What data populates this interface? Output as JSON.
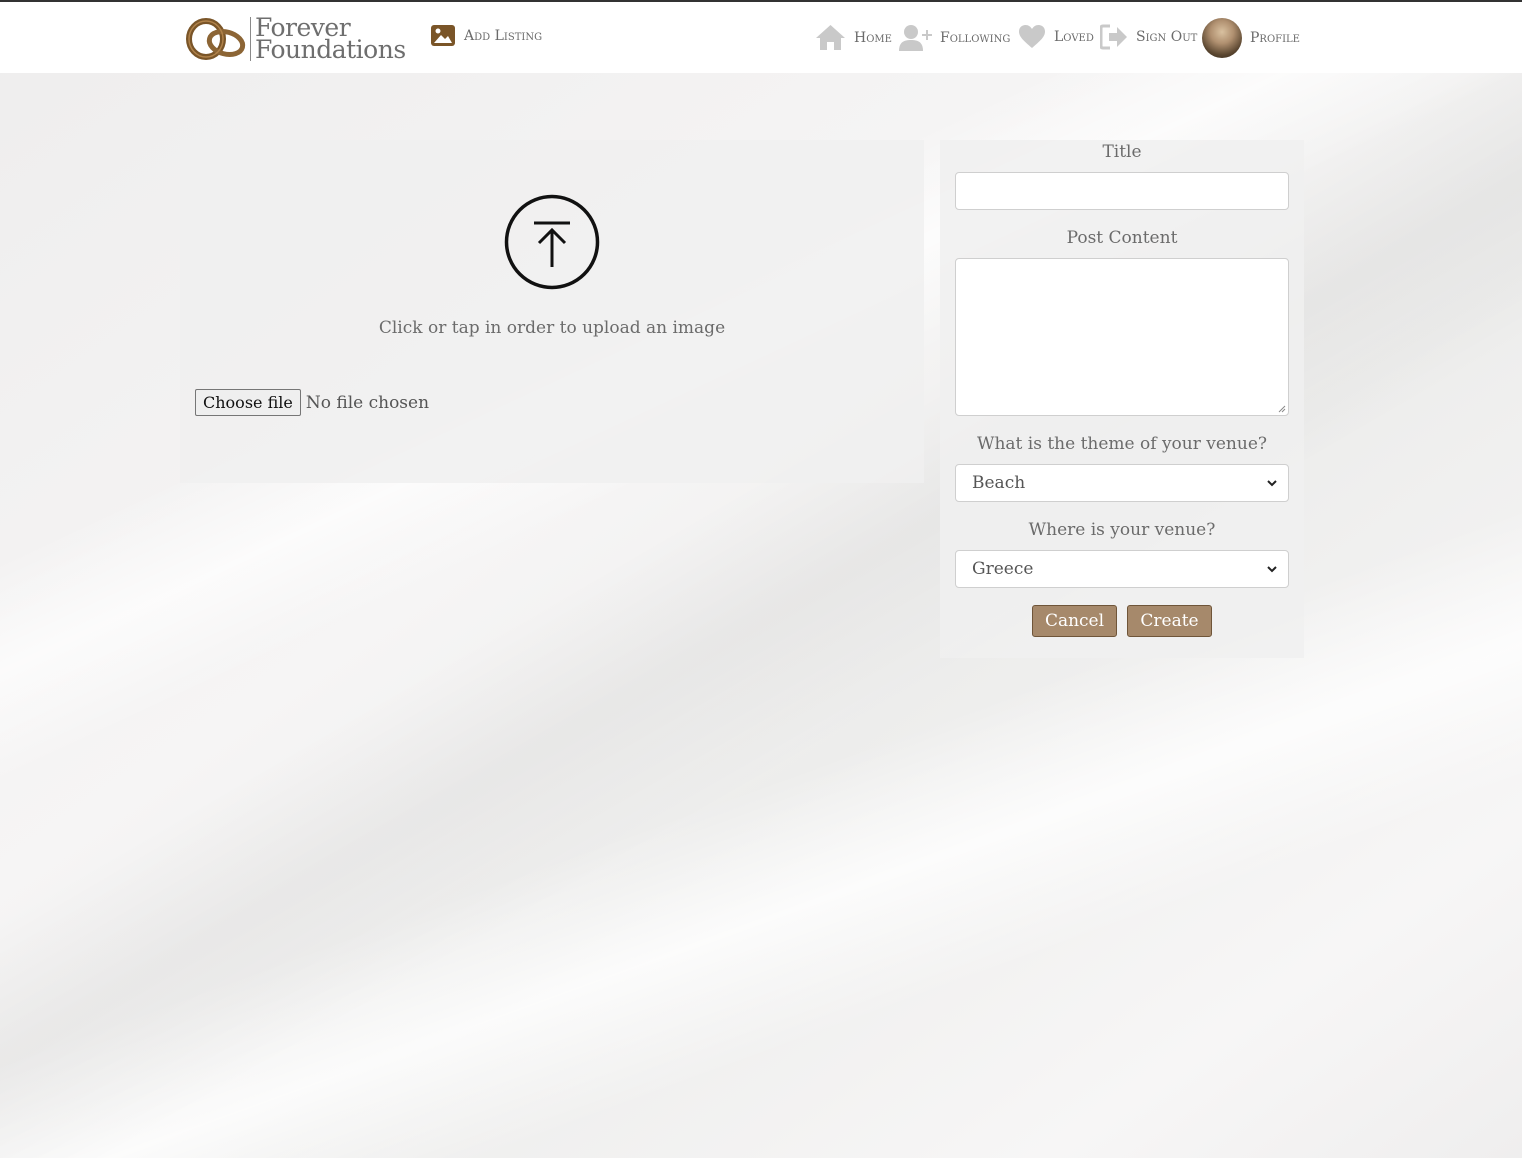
{
  "brand": {
    "line1": "Forever",
    "line2": "Foundations",
    "logo": "rings-logo"
  },
  "nav": {
    "add_listing": "Add Listing",
    "home": "Home",
    "following": "Following",
    "loved": "Loved",
    "sign_out": "Sign Out",
    "profile": "Profile"
  },
  "upload": {
    "prompt": "Click or tap in order to upload an image",
    "choose_file": "Choose file",
    "file_status": "No file chosen"
  },
  "form": {
    "title_label": "Title",
    "title_value": "",
    "content_label": "Post Content",
    "content_value": "",
    "theme_label": "What is the theme of your venue?",
    "theme_selected": "Beach",
    "location_label": "Where is your venue?",
    "location_selected": "Greece",
    "cancel_label": "Cancel",
    "create_label": "Create"
  },
  "colors": {
    "accent": "#a6896b",
    "brand_brown": "#7a5528",
    "nav_icon": "#c9c9c9"
  }
}
